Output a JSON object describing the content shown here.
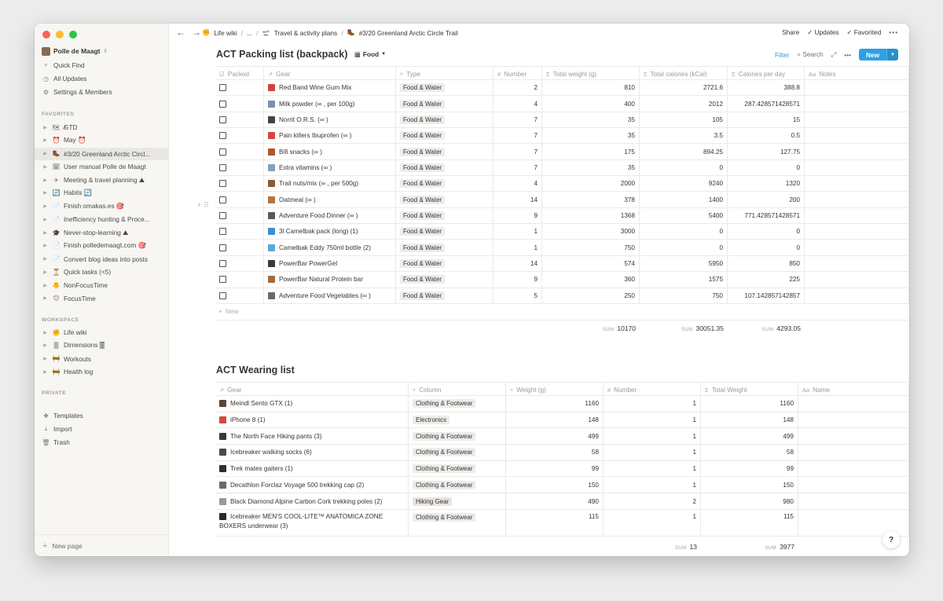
{
  "sidebar": {
    "workspace": "Polle de Maagt",
    "top_items": [
      {
        "label": "Quick Find",
        "icon": "search-icon",
        "glyph": "⌕"
      },
      {
        "label": "All Updates",
        "icon": "clock-icon",
        "glyph": "◷"
      },
      {
        "label": "Settings & Members",
        "icon": "gear-icon",
        "glyph": "⚙"
      }
    ],
    "favorites_title": "FAVORITES",
    "favorites": [
      {
        "label": "GTD",
        "prefix": "🗺 ↗",
        "icon": "map-icon"
      },
      {
        "label": "May ⏰",
        "prefix": "⏰",
        "icon": "alarm-clock-icon"
      },
      {
        "label": "#3/20 Greenland Arctic Circl...",
        "prefix": "🥾",
        "icon": "hiking-boot-icon"
      },
      {
        "label": "User manual Polle de Maagt",
        "prefix": "🗓",
        "icon": "calendar-icon"
      },
      {
        "label": "Meeting & travel planning ⛰",
        "prefix": "✈",
        "icon": "airplane-icon"
      },
      {
        "label": "Habits 🔄",
        "prefix": "🔄",
        "icon": "repeat-icon"
      },
      {
        "label": "Finish omakas.es 🎯",
        "prefix": "📄",
        "icon": "page-icon"
      },
      {
        "label": "Inefficiency hunting & Proce...",
        "prefix": "📄",
        "icon": "page-icon"
      },
      {
        "label": "Never-stop-learning ⛰",
        "prefix": "🎓",
        "icon": "graduation-cap-icon"
      },
      {
        "label": "Finish polledemaagt.com 🎯",
        "prefix": "📄",
        "icon": "page-icon"
      },
      {
        "label": "Convert blog ideas into posts",
        "prefix": "📄",
        "icon": "page-icon"
      },
      {
        "label": "Quick tasks (<5)",
        "prefix": "⏳",
        "icon": "hourglass-icon"
      },
      {
        "label": "NonFocusTime",
        "prefix": "🐥",
        "icon": "chick-icon"
      },
      {
        "label": "FocusTime",
        "prefix": "😊",
        "icon": "smiley-icon"
      }
    ],
    "workspace_title": "WORKSPACE",
    "workspace_items": [
      {
        "label": "Life wiki",
        "prefix": "✊",
        "icon": "fist-icon"
      },
      {
        "label": "Dimensions 🀫",
        "prefix": "🀫",
        "icon": "tile-icon"
      },
      {
        "label": "Workouts",
        "prefix": "🚧",
        "icon": "barrier-icon"
      },
      {
        "label": "Health log",
        "prefix": "🚧",
        "icon": "barrier-icon"
      }
    ],
    "private_title": "PRIVATE",
    "bottom_items": [
      {
        "label": "Templates",
        "icon": "templates-icon",
        "glyph": "❖"
      },
      {
        "label": "Import",
        "icon": "import-icon",
        "glyph": "⤓"
      },
      {
        "label": "Trash",
        "icon": "trash-icon",
        "glyph": "🗑"
      }
    ],
    "new_page": "New page"
  },
  "topbar": {
    "crumbs": [
      "Life wiki",
      "...",
      "Travel & activity plans",
      "#3/20 Greenland Arctic Circle Trail"
    ],
    "share": "Share",
    "updates": "Updates",
    "favorited": "Favorited"
  },
  "packing": {
    "title": "ACT Packing list (backpack)",
    "view": "Food",
    "filter": "Filter",
    "search": "Search",
    "new": "New",
    "columns": [
      "Packed",
      "Gear",
      "Type",
      "Number",
      "Total weight (g)",
      "Total calories (kCal)",
      "Calories per day",
      "Notes"
    ],
    "rows": [
      {
        "gear": "Red Band Wine Gum Mix",
        "type": "Food & Water",
        "number": "2",
        "weight": "810",
        "calories": "2721.6",
        "per_day": "388.8",
        "color": "#c94a3a"
      },
      {
        "gear": "Milk powder (∞ , per 100g)",
        "type": "Food & Water",
        "number": "4",
        "weight": "400",
        "calories": "2012",
        "per_day": "287.428571428571",
        "color": "#7c8fb0"
      },
      {
        "gear": "Norrit O.R.S. (∞ )",
        "type": "Food & Water",
        "number": "7",
        "weight": "35",
        "calories": "105",
        "per_day": "15",
        "color": "#444444"
      },
      {
        "gear": "Pain killers Ibuprofen (∞ )",
        "type": "Food & Water",
        "number": "7",
        "weight": "35",
        "calories": "3.5",
        "per_day": "0.5",
        "color": "#d9453a"
      },
      {
        "gear": "Bifi snacks (∞ )",
        "type": "Food & Water",
        "number": "7",
        "weight": "175",
        "calories": "894.25",
        "per_day": "127.75",
        "color": "#b5542a"
      },
      {
        "gear": "Extra vitamins (∞ )",
        "type": "Food & Water",
        "number": "7",
        "weight": "35",
        "calories": "0",
        "per_day": "0",
        "color": "#8aa0b8"
      },
      {
        "gear": "Trail nuts/mix (∞ , per 500g)",
        "type": "Food & Water",
        "number": "4",
        "weight": "2000",
        "calories": "9240",
        "per_day": "1320",
        "color": "#8d5a34"
      },
      {
        "gear": "Oatmeal (∞ )",
        "type": "Food & Water",
        "number": "14",
        "weight": "378",
        "calories": "1400",
        "per_day": "200",
        "color": "#b7743f"
      },
      {
        "gear": "Adventure Food Dinner (∞ )",
        "type": "Food & Water",
        "number": "9",
        "weight": "1368",
        "calories": "5400",
        "per_day": "771.428571428571",
        "color": "#5a5a5a"
      },
      {
        "gear": "3l Camelbak pack (long) (1)",
        "type": "Food & Water",
        "number": "1",
        "weight": "3000",
        "calories": "0",
        "per_day": "0",
        "color": "#3b8fd0"
      },
      {
        "gear": "Camelbak Eddy 750ml bottle (2)",
        "type": "Food & Water",
        "number": "1",
        "weight": "750",
        "calories": "0",
        "per_day": "0",
        "color": "#5aa9d8"
      },
      {
        "gear": "PowerBar PowerGel",
        "type": "Food & Water",
        "number": "14",
        "weight": "574",
        "calories": "5950",
        "per_day": "850",
        "color": "#3a3a3a"
      },
      {
        "gear": "PowerBar Natural Protein bar",
        "type": "Food & Water",
        "number": "9",
        "weight": "360",
        "calories": "1575",
        "per_day": "225",
        "color": "#a86a3a"
      },
      {
        "gear": "Adventure Food Vegetables (∞ )",
        "type": "Food & Water",
        "number": "5",
        "weight": "250",
        "calories": "750",
        "per_day": "107.142857142857",
        "color": "#6a6a6a"
      }
    ],
    "new_row": "New",
    "sum_label": "SUM",
    "sums": {
      "weight": "10170",
      "calories": "30051.35",
      "per_day": "4293.05"
    }
  },
  "wearing": {
    "title": "ACT Wearing list",
    "columns": [
      "Gear",
      "Column",
      "Weight (g)",
      "Number",
      "Total Weight",
      "Name"
    ],
    "rows": [
      {
        "gear": "Meindl Sento GTX (1)",
        "gear2": "",
        "type": "Clothing & Footwear",
        "weight": "1160",
        "number": "1",
        "total": "1160",
        "color": "#5a4636",
        "tag": "tag-cf"
      },
      {
        "gear": "iPhone 8 (1)",
        "gear2": "",
        "type": "Electronics",
        "weight": "148",
        "number": "1",
        "total": "148",
        "color": "#d8453a",
        "tag": "tag-el"
      },
      {
        "gear": "The North Face Hiking pants (3)",
        "gear2": "",
        "type": "Clothing & Footwear",
        "weight": "499",
        "number": "1",
        "total": "499",
        "color": "#3a3a3a",
        "tag": "tag-cf"
      },
      {
        "gear": "Icebreaker walking socks (6)",
        "gear2": "",
        "type": "Clothing & Footwear",
        "weight": "58",
        "number": "1",
        "total": "58",
        "color": "#4a4a4a",
        "tag": "tag-cf"
      },
      {
        "gear": "Trek mates gaiters (1)",
        "gear2": "",
        "type": "Clothing & Footwear",
        "weight": "99",
        "number": "1",
        "total": "99",
        "color": "#2f2f2f",
        "tag": "tag-cf"
      },
      {
        "gear": "Decathlon Forclaz Voyage 500 trekking cap (2)",
        "gear2": "",
        "type": "Clothing & Footwear",
        "weight": "150",
        "number": "1",
        "total": "150",
        "color": "#6b6b6b",
        "tag": "tag-cf"
      },
      {
        "gear": "Black Diamond Alpine Carbon Cork trekking poles (2)",
        "gear2": "",
        "type": "Hiking Gear",
        "weight": "490",
        "number": "2",
        "total": "980",
        "color": "#9a9a9a",
        "tag": "tag-hg"
      },
      {
        "gear": "Icebreaker MEN'S COOL-LITE™ ANATOMICA ZONE",
        "gear2": "BOXERS underwear (3)",
        "type": "Clothing & Footwear",
        "weight": "115",
        "number": "1",
        "total": "115",
        "color": "#2a2a2a",
        "tag": "tag-cf"
      }
    ],
    "sum_label": "SUM",
    "sums": {
      "number": "13",
      "total": "3977"
    }
  },
  "help": "?"
}
